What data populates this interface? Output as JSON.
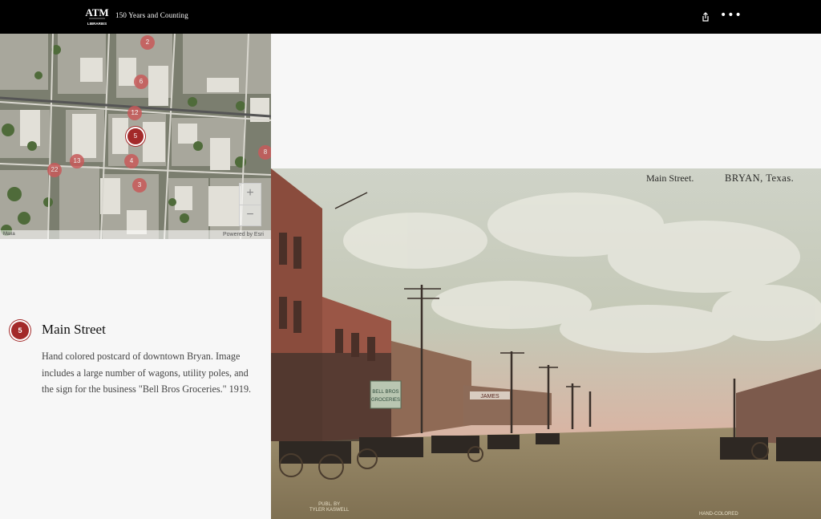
{
  "header": {
    "logo_text": "LIBRARIES",
    "title": "150 Years and Counting",
    "share_icon": "share-icon",
    "more_icon": "more-icon",
    "more_glyph": "•••"
  },
  "map": {
    "markers": [
      {
        "label": "2"
      },
      {
        "label": "6"
      },
      {
        "label": "12"
      },
      {
        "label": "5"
      },
      {
        "label": "8"
      },
      {
        "label": "13"
      },
      {
        "label": "22"
      },
      {
        "label": "4"
      },
      {
        "label": "3"
      }
    ],
    "zoom_in": "+",
    "zoom_out": "−",
    "attribution_left": "Maxa",
    "attribution_right": "Powered by Esri"
  },
  "place": {
    "number": "5",
    "title": "Main Street",
    "description": "Hand colored postcard of downtown Bryan. Image includes a large number of wagons, utility poles, and the sign for the business \"Bell Bros Groceries.\" 1919."
  },
  "postcard": {
    "caption_left": "Main Street.",
    "caption_right": "BRYAN, Texas.",
    "publisher_line1": "PUBL. BY",
    "publisher_line2": "TYLER KASWELL",
    "hand_colored": "HAND-COLORED",
    "sign_groceries": "BELL BROS GROCERIES",
    "sign_james": "JAMES",
    "colors": {
      "sky": "#c9cfc4",
      "dirt": "#8d7e5e",
      "brick": "#8a4c3d"
    }
  }
}
